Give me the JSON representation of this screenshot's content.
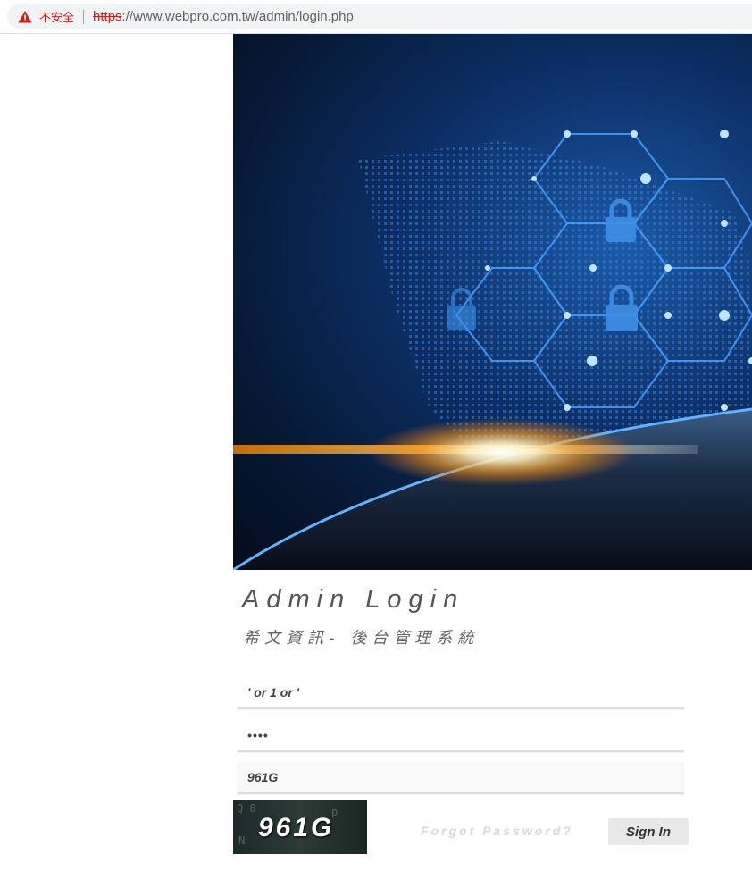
{
  "browser": {
    "security_label": "不安全",
    "url_scheme": "https",
    "url_rest": "://www.webpro.com.tw/admin/login.php"
  },
  "hero": {
    "icon": "cyber-security-globe-image",
    "accent": "#1c5aa8"
  },
  "login": {
    "title": "Admin Login",
    "subtitle": "希文資訊- 後台管理系統",
    "username_value": "' or 1 or '",
    "password_value": "••••",
    "captcha_value": "961G",
    "captcha_image_text": "961G",
    "forgot_label": "Forgot Password?",
    "sign_in_label": "Sign In"
  },
  "colors": {
    "warning_red": "#c5221f",
    "button_bg": "#e8e8e8"
  }
}
